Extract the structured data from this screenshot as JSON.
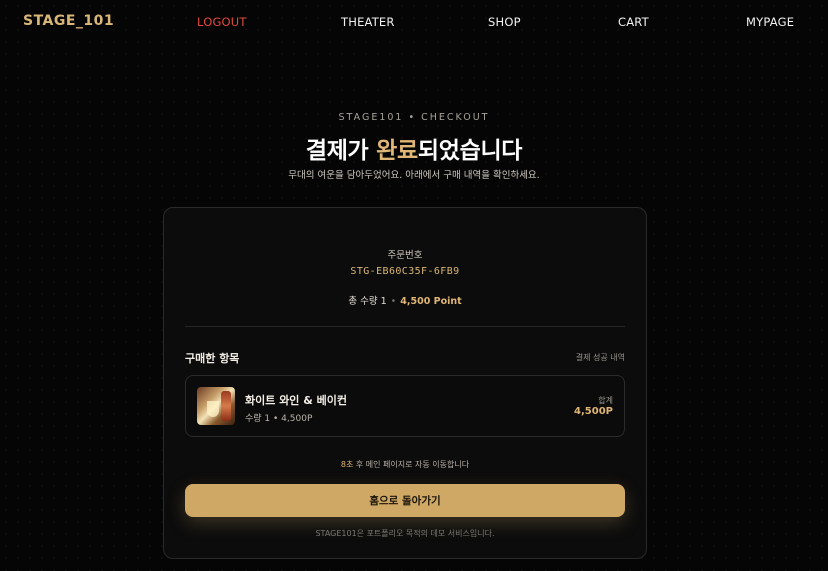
{
  "nav": {
    "brand": "STAGE_101",
    "logout": "LOGOUT",
    "theater": "THEATER",
    "shop": "SHOP",
    "cart": "CART",
    "mypage": "MYPAGE"
  },
  "hero": {
    "eyebrow": "STAGE101 • CHECKOUT",
    "headline_pre": "결제가 ",
    "headline_accent": "완료",
    "headline_post": "되었습니다",
    "subline": "무대의 여운을 담아두었어요. 아래에서 구매 내역을 확인하세요."
  },
  "order": {
    "label": "주문번호",
    "number": "STG-EB60C35F-6FB9",
    "summary_qty": "총 수량 1",
    "summary_sep": "•",
    "summary_points": "4,500 Point"
  },
  "items_section": {
    "title": "구매한 항목",
    "meta": "결제 성공 내역",
    "items": [
      {
        "name": "화이트 와인 & 베이컨",
        "qty_price": "수량 1 • 4,500P",
        "total_label": "합계",
        "total": "4,500P"
      }
    ]
  },
  "redirect": {
    "seconds": "8초",
    "text": " 후 메인 페이지로 자동 이동합니다"
  },
  "home_button": "홈으로 돌아가기",
  "footnote": "STAGE101은 포트폴리오 목적의 데모 서비스입니다.",
  "colors": {
    "accent": "#d9b778",
    "logout": "#e24b3d",
    "button": "#cfa866",
    "background": "#050505"
  }
}
